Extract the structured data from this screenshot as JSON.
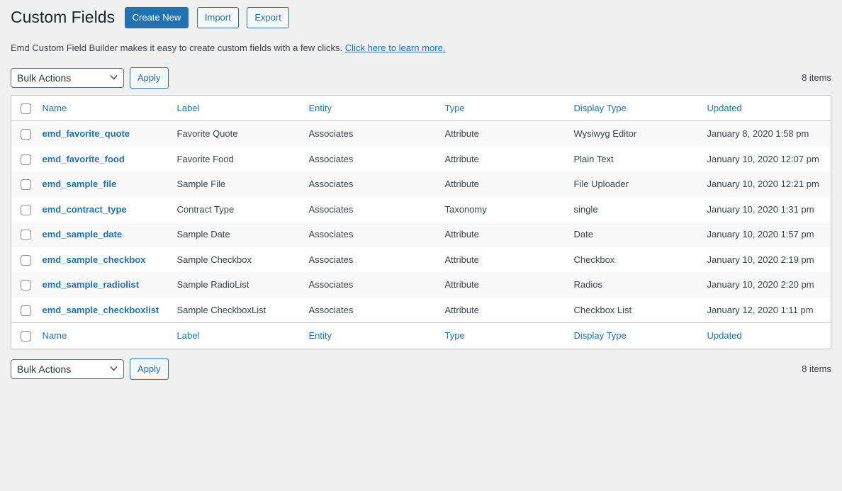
{
  "page": {
    "title": "Custom Fields",
    "create_new_label": "Create New",
    "import_label": "Import",
    "export_label": "Export",
    "description": "Emd Custom Field Builder makes it easy to create custom fields with a few clicks.",
    "learn_more_link": "Click here to learn more."
  },
  "tablenav": {
    "bulk_actions_selected": "Bulk Actions",
    "apply_label": "Apply",
    "items_count": "8 items"
  },
  "table": {
    "columns": [
      "Name",
      "Label",
      "Entity",
      "Type",
      "Display Type",
      "Updated"
    ],
    "rows": [
      {
        "name": "emd_favorite_quote",
        "label": "Favorite Quote",
        "entity": "Associates",
        "type": "Attribute",
        "display_type": "Wysiwyg Editor",
        "updated": "January 8, 2020 1:58 pm"
      },
      {
        "name": "emd_favorite_food",
        "label": "Favorite Food",
        "entity": "Associates",
        "type": "Attribute",
        "display_type": "Plain Text",
        "updated": "January 10, 2020 12:07 pm"
      },
      {
        "name": "emd_sample_file",
        "label": "Sample File",
        "entity": "Associates",
        "type": "Attribute",
        "display_type": "File Uploader",
        "updated": "January 10, 2020 12:21 pm"
      },
      {
        "name": "emd_contract_type",
        "label": "Contract Type",
        "entity": "Associates",
        "type": "Taxonomy",
        "display_type": "single",
        "updated": "January 10, 2020 1:31 pm"
      },
      {
        "name": "emd_sample_date",
        "label": "Sample Date",
        "entity": "Associates",
        "type": "Attribute",
        "display_type": "Date",
        "updated": "January 10, 2020 1:57 pm"
      },
      {
        "name": "emd_sample_checkbox",
        "label": "Sample Checkbox",
        "entity": "Associates",
        "type": "Attribute",
        "display_type": "Checkbox",
        "updated": "January 10, 2020 2:19 pm"
      },
      {
        "name": "emd_sample_radiolist",
        "label": "Sample RadioList",
        "entity": "Associates",
        "type": "Attribute",
        "display_type": "Radios",
        "updated": "January 10, 2020 2:20 pm"
      },
      {
        "name": "emd_sample_checkboxlist",
        "label": "Sample CheckboxList",
        "entity": "Associates",
        "type": "Attribute",
        "display_type": "Checkbox List",
        "updated": "January 12, 2020 1:11 pm"
      }
    ]
  },
  "colors": {
    "accent": "#2271b1",
    "page_background": "#f0f0f1",
    "table_border": "#c3c4c7",
    "row_stripe": "#f9f9f9",
    "text": "#3c434a"
  }
}
